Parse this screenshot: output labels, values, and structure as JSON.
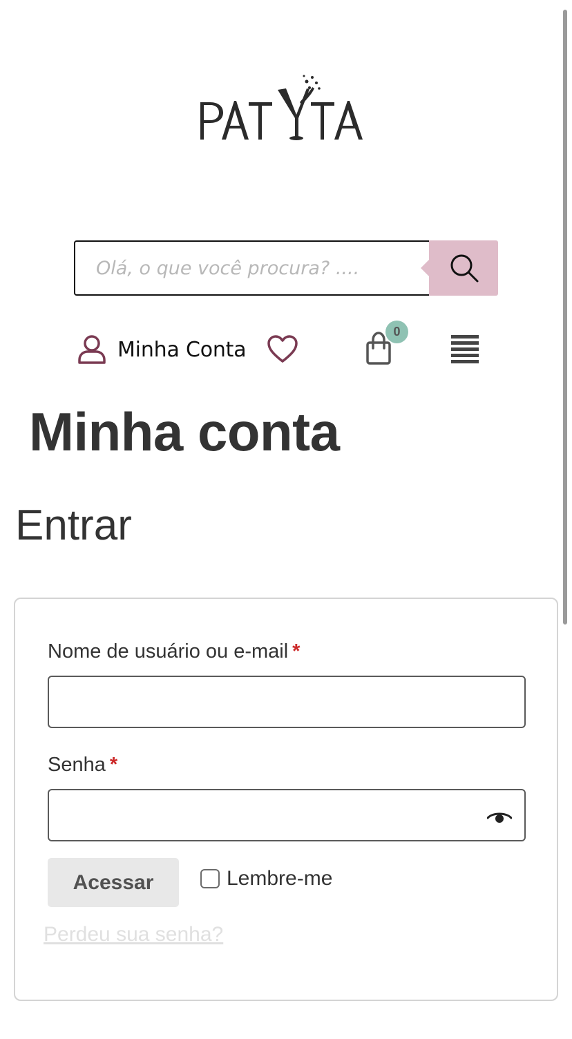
{
  "header": {
    "logo_text": "PATYTA",
    "search": {
      "placeholder": "Olá, o que você procura? ....",
      "button_icon": "search-icon"
    },
    "account_label": "Minha Conta",
    "account_icon": "user-icon",
    "wishlist_icon": "heart-icon",
    "cart_icon": "shopping-bag-icon",
    "cart_count": "0",
    "menu_icon": "hamburger-menu-icon",
    "colors": {
      "accent": "#dfbcc9",
      "icon_wine": "#7a3a52",
      "badge": "#8fc2b3"
    }
  },
  "main": {
    "page_title": "Minha conta",
    "login": {
      "title": "Entrar",
      "username_label": "Nome de usuário ou e-mail",
      "password_label": "Senha",
      "required_marker": "*",
      "password_toggle_icon": "eye-icon",
      "submit_label": "Acessar",
      "remember_label": "Lembre-me",
      "lost_password_label": "Perdeu sua senha?"
    }
  }
}
